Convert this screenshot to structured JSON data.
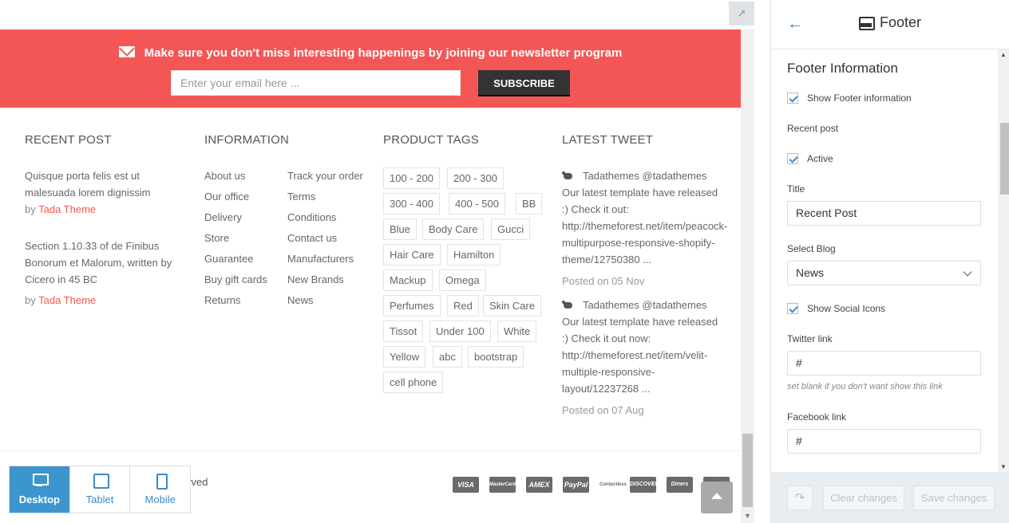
{
  "newsletter": {
    "message": "Make sure you don't miss interesting happenings by joining our newsletter program",
    "placeholder": "Enter your email here ...",
    "subscribe_label": "SUBSCRIBE"
  },
  "recent_post": {
    "title": "RECENT POST",
    "posts": [
      {
        "line1": "Quisque porta felis est ut",
        "line2": "malesuada lorem dignissim",
        "by": "by ",
        "author": "Tada Theme"
      },
      {
        "line1": "Section 1.10.33 of de Finibus",
        "line2": "Bonorum et Malorum, written by",
        "line3": "Cicero in 45 BC",
        "by": "by ",
        "author": "Tada Theme"
      }
    ]
  },
  "information": {
    "title": "INFORMATION",
    "col1": [
      "About us",
      "Our office",
      "Delivery",
      "Store",
      "Guarantee",
      "Buy gift cards",
      "Returns"
    ],
    "col2": [
      "Track your order",
      "Terms",
      "Conditions",
      "Contact us",
      "Manufacturers",
      "New Brands",
      "News"
    ]
  },
  "product_tags": {
    "title": "PRODUCT TAGS",
    "tags": [
      "100 - 200",
      "200 - 300",
      "300 - 400",
      "400 - 500",
      "BB",
      "Blue",
      "Body Care",
      "Gucci",
      "Hair Care",
      "Hamilton",
      "Mackup",
      "Omega",
      "Perfumes",
      "Red",
      "Skin Care",
      "Tissot",
      "Under 100",
      "White",
      "Yellow",
      "abc",
      "bootstrap",
      "cell phone"
    ]
  },
  "latest_tweet": {
    "title": "LATEST TWEET",
    "tweets": [
      {
        "handle": "Tadathemes @tadathemes",
        "lines": [
          "Our latest template have released",
          ":) Check it out:",
          "http://themeforest.net/item/peacock-",
          "multipurpose-responsive-shopify-",
          "theme/12750380 ..."
        ],
        "date": "Posted on 05 Nov"
      },
      {
        "handle": "Tadathemes @tadathemes",
        "lines": [
          "Our latest template have released",
          ":) Check it out now:",
          "http://themeforest.net/item/velit-",
          "multiple-responsive-",
          "layout/12237268 ..."
        ],
        "date": "Posted on 07 Aug"
      }
    ]
  },
  "footer_bottom": {
    "copyright_visible": "erved",
    "payment_icons": [
      "VISA",
      "MasterCard",
      "AMEX",
      "PayPal",
      "Contactless",
      "DISCOVER",
      "Diners",
      "Card"
    ]
  },
  "devices": {
    "desktop": "Desktop",
    "tablet": "Tablet",
    "mobile": "Mobile",
    "active": "Desktop"
  },
  "panel": {
    "title": "Footer",
    "section_title": "Footer Information",
    "show_footer_info": "Show Footer information",
    "recent_post_label": "Recent post",
    "active_label": "Active",
    "title_label": "Title",
    "title_value": "Recent Post",
    "select_blog_label": "Select Blog",
    "select_blog_value": "News",
    "show_social_icons": "Show Social Icons",
    "twitter_label": "Twitter link",
    "twitter_value": "#",
    "twitter_hint": "set blank if you don't want show this link",
    "facebook_label": "Facebook link",
    "facebook_value": "#",
    "clear_label": "Clear changes",
    "save_label": "Save changes"
  },
  "colors": {
    "accent_red": "#f45656",
    "primary_blue": "#3d95ce"
  }
}
